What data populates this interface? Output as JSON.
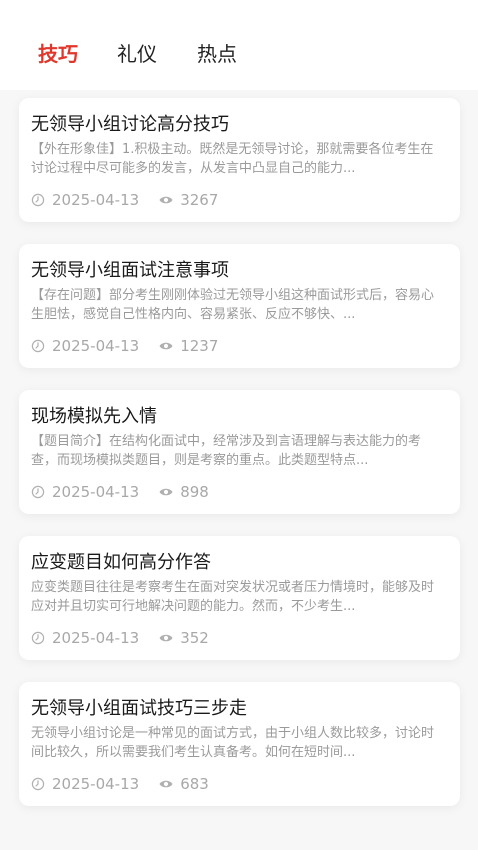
{
  "tabs": [
    {
      "label": "技巧",
      "active": true
    },
    {
      "label": "礼仪",
      "active": false
    },
    {
      "label": "热点",
      "active": false
    }
  ],
  "colors": {
    "accent": "#e0362c",
    "title": "#1a1a1a",
    "summary": "#9a9a9a",
    "meta": "#a8a8a8",
    "background": "#f7f7f7"
  },
  "articles": [
    {
      "title": "无领导小组讨论高分技巧",
      "summary": "【外在形象佳】1.积极主动。既然是无领导讨论，那就需要各位考生在讨论过程中尽可能多的发言，从发言中凸显自己的能力...",
      "date_icon": "clock-icon",
      "date": "2025-04-13",
      "views_icon": "eye-icon",
      "views": "3267"
    },
    {
      "title": "无领导小组面试注意事项",
      "summary": "【存在问题】部分考生刚刚体验过无领导小组这种面试形式后，容易心生胆怯，感觉自己性格内向、容易紧张、反应不够快、...",
      "date_icon": "clock-icon",
      "date": "2025-04-13",
      "views_icon": "eye-icon",
      "views": "1237"
    },
    {
      "title": "现场模拟先入情",
      "summary": "【题目简介】在结构化面试中，经常涉及到言语理解与表达能力的考查，而现场模拟类题目，则是考察的重点。此类题型特点...",
      "date_icon": "clock-icon",
      "date": "2025-04-13",
      "views_icon": "eye-icon",
      "views": "898"
    },
    {
      "title": "应变题目如何高分作答",
      "summary": "应变类题目往往是考察考生在面对突发状况或者压力情境时，能够及时应对并且切实可行地解决问题的能力。然而，不少考生...",
      "date_icon": "clock-icon",
      "date": "2025-04-13",
      "views_icon": "eye-icon",
      "views": "352"
    },
    {
      "title": "无领导小组面试技巧三步走",
      "summary": "无领导小组讨论是一种常见的面试方式，由于小组人数比较多，讨论时间比较久，所以需要我们考生认真备考。如何在短时间...",
      "date_icon": "clock-icon",
      "date": "2025-04-13",
      "views_icon": "eye-icon",
      "views": "683"
    }
  ]
}
